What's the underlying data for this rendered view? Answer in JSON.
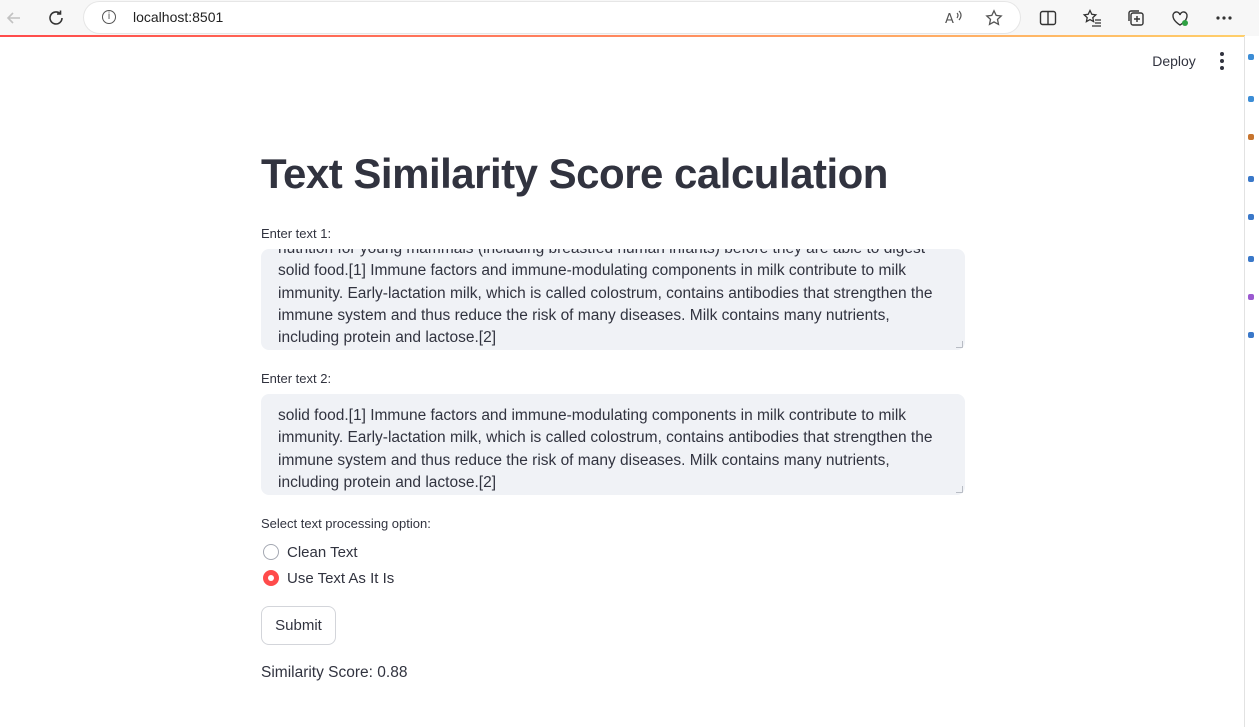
{
  "browser": {
    "url": "localhost:8501",
    "info_glyph": "i",
    "icons": {
      "back": "back-arrow-icon",
      "reload": "reload-icon",
      "read_aloud": "read-aloud-icon",
      "favorite": "star-icon",
      "split": "split-screen-icon",
      "favorites": "favorites-list-icon",
      "collections": "collections-icon",
      "extensions": "extensions-icon",
      "more": "more-dots-icon"
    }
  },
  "header": {
    "deploy_label": "Deploy"
  },
  "main": {
    "title": "Text Similarity Score calculation",
    "text1": {
      "label": "Enter text 1:",
      "value": "nutrition for young mammals (including breastfed human infants) before they are able to digest solid food.[1] Immune factors and immune-modulating components in milk contribute to milk immunity. Early-lactation milk, which is called colostrum, contains antibodies that strengthen the immune system and thus reduce the risk of many diseases. Milk contains many nutrients, including protein and lactose.[2]"
    },
    "text2": {
      "label": "Enter text 2:",
      "value": "solid food.[1] Immune factors and immune-modulating components in milk contribute to milk immunity. Early-lactation milk, which is called colostrum, contains antibodies that strengthen the immune system and thus reduce the risk of many diseases. Milk contains many nutrients, including protein and lactose.[2]"
    },
    "processing": {
      "label": "Select text processing option:",
      "options": [
        "Clean Text",
        "Use Text As It Is"
      ],
      "selected": "Use Text As It Is"
    },
    "submit_label": "Submit",
    "result": "Similarity Score: 0.88"
  },
  "colors": {
    "accent": "#ff4b4b",
    "text": "#31333f",
    "input_bg": "#f0f2f6"
  }
}
